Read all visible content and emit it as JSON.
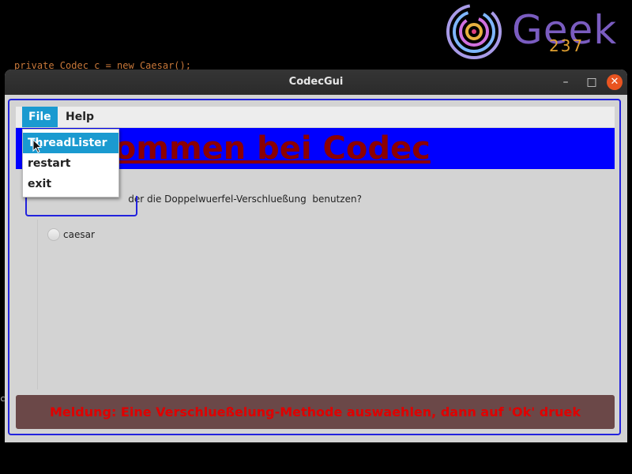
{
  "background": {
    "code_line": "private Codec c = new Caesar();"
  },
  "logo": {
    "word": "Geek",
    "number": "237",
    "colors": {
      "text": "#7a5cc0",
      "number": "#e0a030"
    }
  },
  "window": {
    "title": "CodecGui",
    "controls": {
      "minimize": "–",
      "maximize": "□",
      "close": "✕"
    }
  },
  "menubar": {
    "items": [
      {
        "label": "File",
        "active": true
      },
      {
        "label": "Help",
        "active": false
      }
    ]
  },
  "file_menu": {
    "items": [
      {
        "label": "ThreadLister",
        "highlighted": true
      },
      {
        "label": "restart",
        "highlighted": false
      },
      {
        "label": "exit",
        "highlighted": false
      }
    ]
  },
  "banner": {
    "visible_text": "Willkommen bei Codec",
    "colors": {
      "background": "#0000ff",
      "text": "#8b0000"
    }
  },
  "question": {
    "visible_text": "der die Doppelwuerfel-Verschlueßung  benutzen?"
  },
  "options": [
    {
      "label": "caesar",
      "selected": false
    }
  ],
  "status": {
    "message": "Meldung: Eine Verschlueßelung-Methode auswaehlen, dann auf 'Ok' druek",
    "colors": {
      "background": "#6b4848",
      "text": "#e00000"
    }
  },
  "icons": [
    "minimize-icon",
    "maximize-icon",
    "close-icon",
    "radio-unchecked-icon",
    "mouse-pointer-icon",
    "geek237-logo-icon"
  ]
}
